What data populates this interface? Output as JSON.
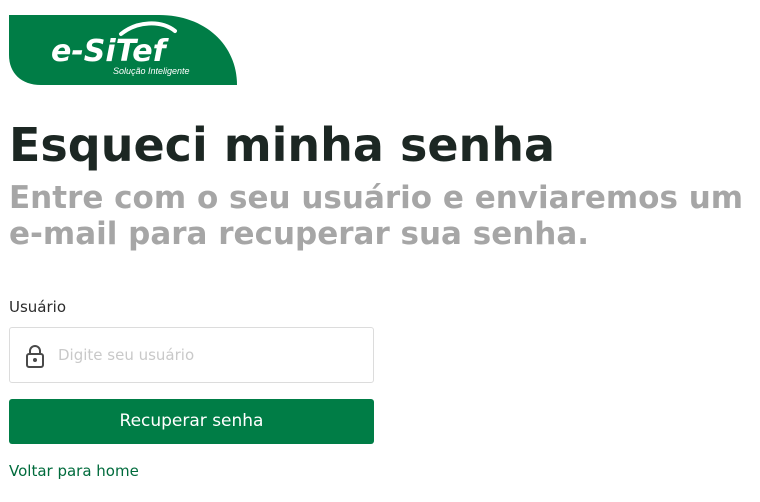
{
  "brand": {
    "wordmark": "e-SiTef",
    "tagline": "Solução Inteligente",
    "color": "#007d46"
  },
  "header": {
    "title": "Esqueci minha senha",
    "subtitle": "Entre com o seu usuário e enviaremos um e-mail para recuperar sua senha."
  },
  "form": {
    "username_label": "Usuário",
    "username_placeholder": "Digite seu usuário",
    "username_value": "",
    "username_icon": "lock-icon",
    "submit_label": "Recuperar senha"
  },
  "footer": {
    "back_link": "Voltar para home"
  },
  "colors": {
    "accent": "#007d46",
    "title": "#1c2723",
    "subtitle": "#a6a6a6",
    "link": "#006b3c"
  }
}
